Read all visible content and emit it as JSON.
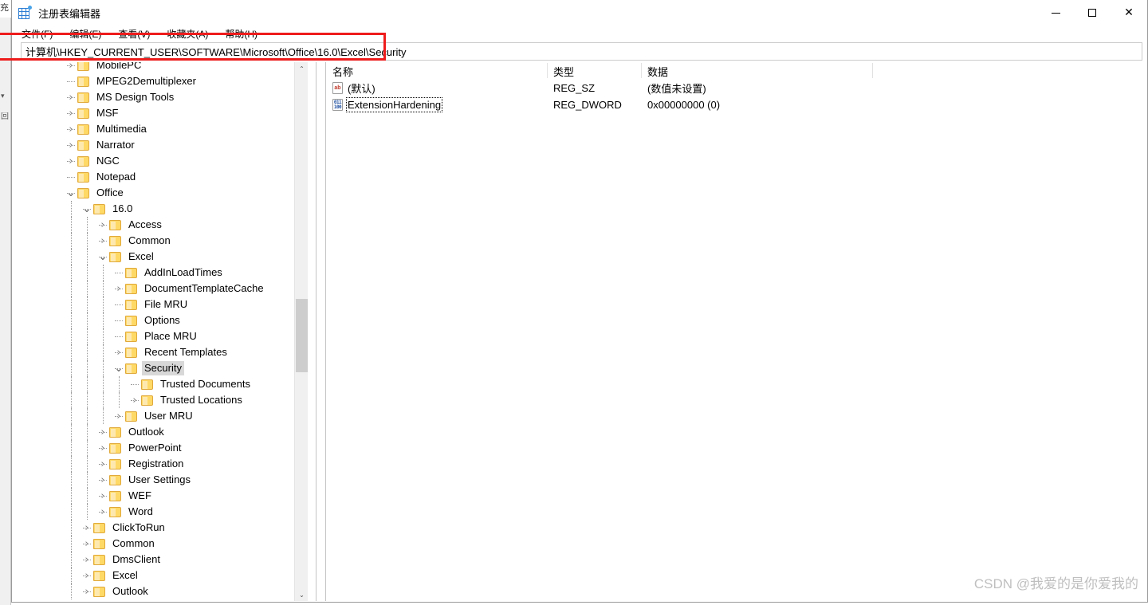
{
  "window": {
    "title": "注册表编辑器",
    "app_icon": "registry-icon",
    "controls": {
      "minimize": "—",
      "maximize": "□",
      "close": "✕"
    }
  },
  "menu": {
    "items": [
      {
        "label": "文件(F)"
      },
      {
        "label": "编辑(E)"
      },
      {
        "label": "查看(V)"
      },
      {
        "label": "收藏夹(A)"
      },
      {
        "label": "帮助(H)"
      }
    ]
  },
  "address": {
    "value": "计算机\\HKEY_CURRENT_USER\\SOFTWARE\\Microsoft\\Office\\16.0\\Excel\\Security",
    "placeholder": ""
  },
  "annotation": {
    "color": "#ee1c1c"
  },
  "tree": {
    "items": [
      {
        "label": "MobilePC",
        "depth": 1,
        "state": "collapsed",
        "selected": false
      },
      {
        "label": "MPEG2Demultiplexer",
        "depth": 1,
        "state": "leaf",
        "selected": false
      },
      {
        "label": "MS Design Tools",
        "depth": 1,
        "state": "collapsed",
        "selected": false
      },
      {
        "label": "MSF",
        "depth": 1,
        "state": "collapsed",
        "selected": false
      },
      {
        "label": "Multimedia",
        "depth": 1,
        "state": "collapsed",
        "selected": false
      },
      {
        "label": "Narrator",
        "depth": 1,
        "state": "collapsed",
        "selected": false
      },
      {
        "label": "NGC",
        "depth": 1,
        "state": "collapsed",
        "selected": false
      },
      {
        "label": "Notepad",
        "depth": 1,
        "state": "leaf",
        "selected": false
      },
      {
        "label": "Office",
        "depth": 1,
        "state": "expanded",
        "selected": false
      },
      {
        "label": "16.0",
        "depth": 2,
        "state": "expanded",
        "selected": false
      },
      {
        "label": "Access",
        "depth": 3,
        "state": "collapsed",
        "selected": false
      },
      {
        "label": "Common",
        "depth": 3,
        "state": "collapsed",
        "selected": false
      },
      {
        "label": "Excel",
        "depth": 3,
        "state": "expanded",
        "selected": false
      },
      {
        "label": "AddInLoadTimes",
        "depth": 4,
        "state": "leaf",
        "selected": false
      },
      {
        "label": "DocumentTemplateCache",
        "depth": 4,
        "state": "collapsed",
        "selected": false
      },
      {
        "label": "File MRU",
        "depth": 4,
        "state": "leaf",
        "selected": false
      },
      {
        "label": "Options",
        "depth": 4,
        "state": "leaf",
        "selected": false
      },
      {
        "label": "Place MRU",
        "depth": 4,
        "state": "leaf",
        "selected": false
      },
      {
        "label": "Recent Templates",
        "depth": 4,
        "state": "collapsed",
        "selected": false
      },
      {
        "label": "Security",
        "depth": 4,
        "state": "expanded",
        "selected": true
      },
      {
        "label": "Trusted Documents",
        "depth": 5,
        "state": "leaf",
        "selected": false
      },
      {
        "label": "Trusted Locations",
        "depth": 5,
        "state": "collapsed",
        "selected": false
      },
      {
        "label": "User MRU",
        "depth": 4,
        "state": "collapsed",
        "selected": false
      },
      {
        "label": "Outlook",
        "depth": 3,
        "state": "collapsed",
        "selected": false
      },
      {
        "label": "PowerPoint",
        "depth": 3,
        "state": "collapsed",
        "selected": false
      },
      {
        "label": "Registration",
        "depth": 3,
        "state": "collapsed",
        "selected": false
      },
      {
        "label": "User Settings",
        "depth": 3,
        "state": "collapsed",
        "selected": false
      },
      {
        "label": "WEF",
        "depth": 3,
        "state": "collapsed",
        "selected": false
      },
      {
        "label": "Word",
        "depth": 3,
        "state": "collapsed",
        "selected": false
      },
      {
        "label": "ClickToRun",
        "depth": 2,
        "state": "collapsed",
        "selected": false
      },
      {
        "label": "Common",
        "depth": 2,
        "state": "collapsed",
        "selected": false
      },
      {
        "label": "DmsClient",
        "depth": 2,
        "state": "collapsed",
        "selected": false
      },
      {
        "label": "Excel",
        "depth": 2,
        "state": "collapsed",
        "selected": false
      },
      {
        "label": "Outlook",
        "depth": 2,
        "state": "collapsed",
        "selected": false
      }
    ],
    "scrollbar": {
      "up_arrow": "⌃",
      "down_arrow": "⌄"
    }
  },
  "values": {
    "columns": [
      {
        "label": "名称"
      },
      {
        "label": "类型"
      },
      {
        "label": "数据"
      }
    ],
    "rows": [
      {
        "icon": "string-value-icon",
        "icon_text": "ab",
        "name": "(默认)",
        "type": "REG_SZ",
        "data": "(数值未设置)",
        "focused": false
      },
      {
        "icon": "binary-value-icon",
        "icon_top": "011",
        "icon_bottom": "100",
        "name": "ExtensionHardening",
        "type": "REG_DWORD",
        "data": "0x00000000 (0)",
        "focused": true
      }
    ]
  },
  "background_window": {
    "glyph_top": "充",
    "glyph_mid": "▾",
    "glyph_low": "回"
  },
  "watermark": {
    "text": "CSDN @我爱的是你爱我的"
  }
}
